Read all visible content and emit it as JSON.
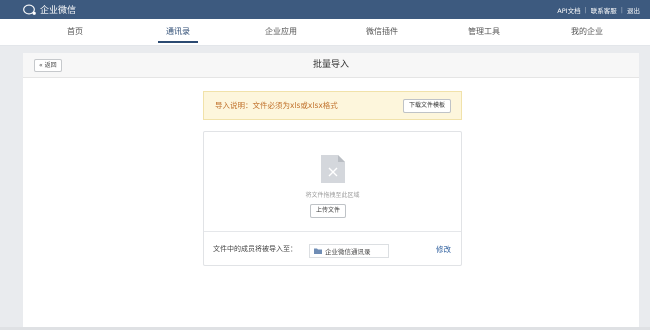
{
  "topbar": {
    "brand": "企业微信",
    "links": [
      "API文档",
      "联系客服",
      "退出"
    ]
  },
  "nav": {
    "items": [
      "首页",
      "通讯录",
      "企业应用",
      "微信插件",
      "管理工具",
      "我的企业"
    ],
    "active": "通讯录"
  },
  "panel": {
    "back_label": "« 返回",
    "title": "批量导入"
  },
  "notice": {
    "text": "导入说明：文件必须为xls或xlsx格式",
    "download_label": "下载文件模板"
  },
  "upload": {
    "hint": "将文件拖拽至此区域",
    "upload_label": "上传文件",
    "target_label": "文件中的成员将被导入至：",
    "target_value": "企业微信通讯录",
    "edit_label": "修改"
  },
  "colors": {
    "topbar": "#3d5a7f",
    "accent": "#2b4a72",
    "notice_bg": "#fdf6dc",
    "notice_text": "#c0702a",
    "link": "#2e5f9e"
  },
  "icons": [
    "wechat-work-logo-icon",
    "file-placeholder-icon",
    "folder-icon"
  ]
}
